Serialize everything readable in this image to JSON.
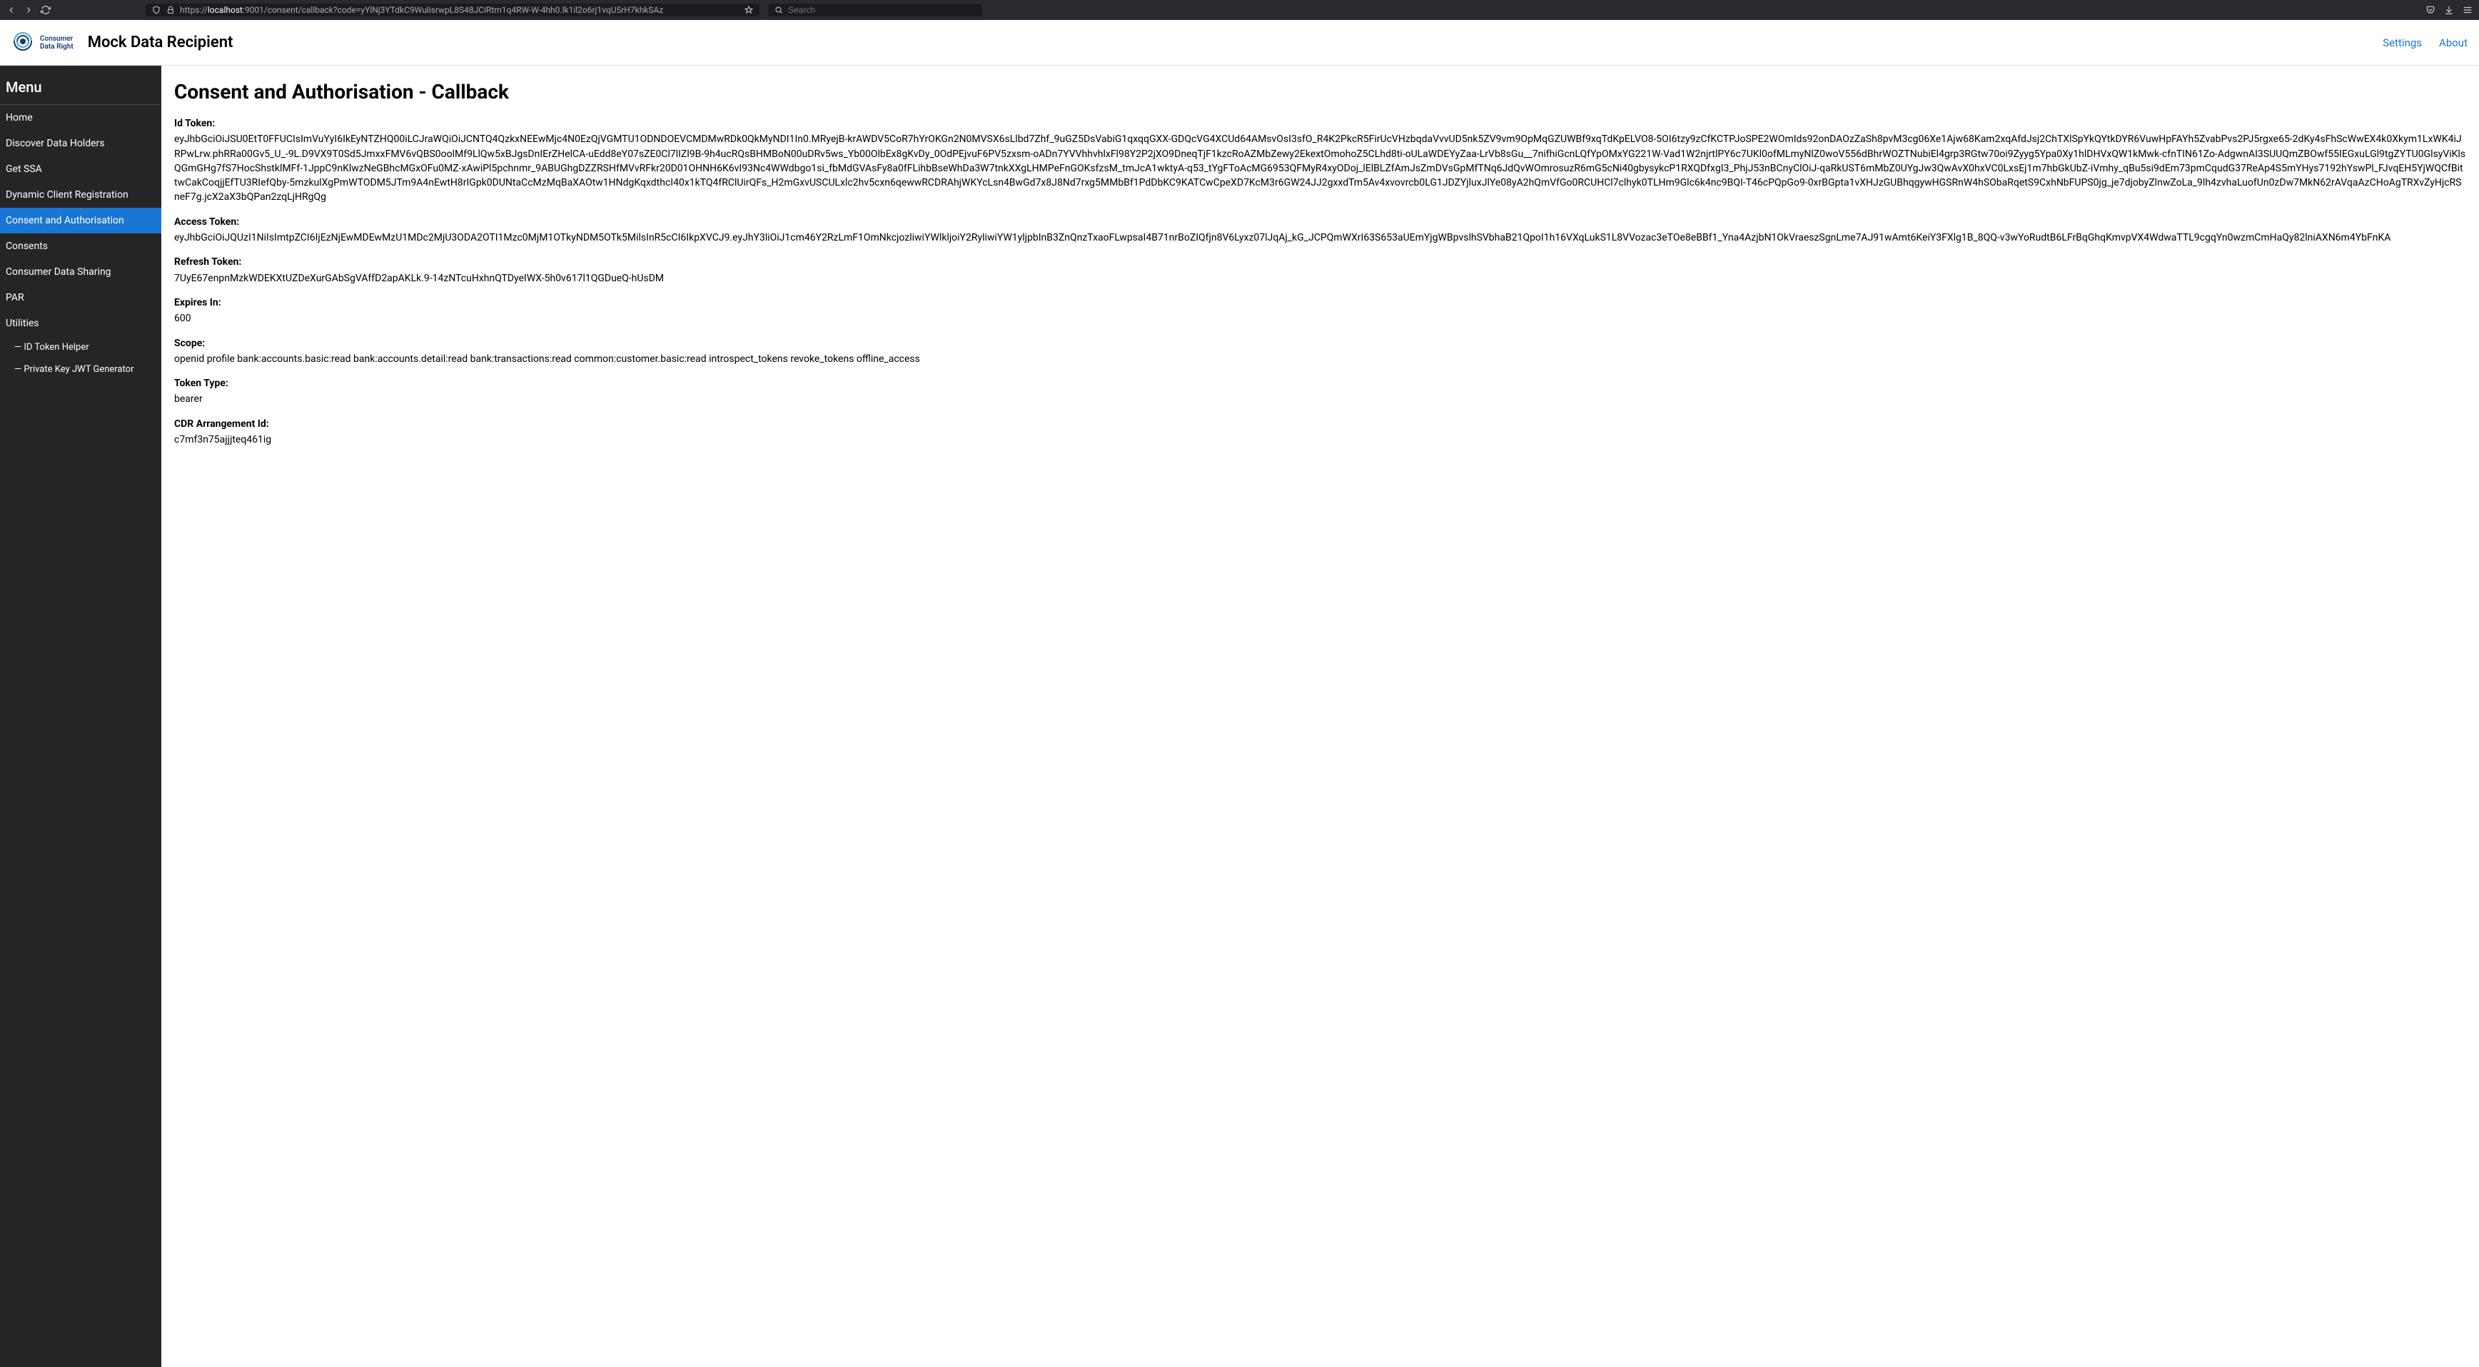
{
  "browser": {
    "url_prefix": "https://",
    "url_host": "localhost",
    "url_rest": ":9001/consent/callback?code=yYlNj3YTdkC9WulisrwpL8S48JCiRtm1q4RW-W-4hh0.lk1il2o6rj1vqU5rH7khkSAz",
    "search_placeholder": "Search"
  },
  "header": {
    "logo_line1": "Consumer",
    "logo_line2": "Data Right",
    "app_title": "Mock Data Recipient",
    "links": {
      "settings": "Settings",
      "about": "About"
    }
  },
  "sidebar": {
    "menu_label": "Menu",
    "items": [
      {
        "label": "Home",
        "active": false
      },
      {
        "label": "Discover Data Holders",
        "active": false
      },
      {
        "label": "Get SSA",
        "active": false
      },
      {
        "label": "Dynamic Client Registration",
        "active": false
      },
      {
        "label": "Consent and Authorisation",
        "active": true
      },
      {
        "label": "Consents",
        "active": false
      },
      {
        "label": "Consumer Data Sharing",
        "active": false
      },
      {
        "label": "PAR",
        "active": false
      },
      {
        "label": "Utilities",
        "active": false
      }
    ],
    "subitems": [
      {
        "label": "— ID Token Helper"
      },
      {
        "label": "— Private Key JWT Generator"
      }
    ]
  },
  "main": {
    "title": "Consent and Authorisation - Callback",
    "fields": [
      {
        "label": "Id Token:",
        "value": "eyJhbGciOiJSU0EtT0FFUCIsImVuYyI6IkEyNTZHQ00iLCJraWQiOiJCNTQ4QzkxNEEwMjc4N0EzQjVGMTU1ODNDOEVCMDMwRDk0QkMyNDI1In0.MRyejB-krAWDV5CoR7hYrOKGn2N0MVSX6sLlbd7Zhf_9uGZ5DsVabiG1qxqqGXX-GDQcVG4XCUd64AMsvOsI3sfO_R4K2PkcR5FirUcVHzbqdaVvvUD5nk5ZV9vm9OpMqGZUWBf9xqTdKpELVO8-5OI6tzy9zCfKCTPJoSPE2WOmIds92onDAOzZaSh8pvM3cg06Xe1Ajw68Kam2xqAfdJsj2ChTXlSpYkQYtkDYR6VuwHpFAYh5ZvabPvs2PJ5rgxe65-2dKy4sFhScWwEX4k0Xkym1LxWK4iJRPwLrw.phRRa00Gv5_U_-9L.D9VX9T0Sd5JmxxFMV6vQBS0oolMf9LlQw5xBJgsDnIErZHelCA-uEdd8eY07sZE0Cl7lIZl9B-9h4ucRQsBHMBoN00uDRv5ws_Yb00OlbEx8gKvDy_0OdPEjvuF6PV5zxsm-oADn7YVVhhvhlxFl98Y2P2jXO9DneqTjF1kzcRoAZMbZewy2EkextOmohoZ5CLhd8ti-oULaWDEYyZaa-LrVb8sGu__7nifhiGcnLQfYpOMxYG221W-Vad1W2njrtlPY6c7UKl0ofMLmyNlZ0woV556dBhrWOZTNubiEl4grp3RGtw70oi9Zyyg5Ypa0Xy1hlDHVxQW1kMwk-cfnTIN61Zo-AdgwnAI3SUUQmZBOwf55IEGxuLGl9tgZYTU0GlsyViKlsQGmGHg7fS7HocShstklMFf-1JppC9nKlwzNeGBhcMGxOFu0MZ-xAwiPl5pchnmr_9ABUGhgDZZRSHfMVvRFkr20D01OHNH6K6vI93Nc4WWdbgo1si_fbMdGVAsFy8a0fFLihbBseWhDa3W7tnkXXgLHMPeFnGOKsfzsM_tmJcA1wktyA-q53_tYgFToAcMG6953QFMyR4xyODoj_lElBLZfAmJsZmDVsGpMfTNq6JdQvWOmrosuzR6mG5cNi40gbysykcP1RXQDfxgI3_PhjJ53nBCnyClOiJ-qaRkUST6mMbZ0UYgJw3QwAvX0hxVC0LxsEj1m7hbGkUbZ-iVmhy_qBu5si9dEm73pmCqudG37ReAp4S5mYHys7192hYswPl_FJvqEH5YjWQCfBittwCakCoqjjEfTU3RIefQby-5mzkulXgPmWTODM5JTm9A4nEwtH8rIGpk0DUNtaCcMzMqBaXAOtw1HNdgKqxdthcI40x1kTQ4fRClUirQFs_H2mGxvUSCULxlc2hv5cxn6qewwRCDRAhjWKYcLsn4BwGd7x8J8Nd7rxg5MMbBf1PdDbKC9KATCwCpeXD7KcM3r6GW24JJ2gxxdTm5Av4xvovrcb0LG1JDZYjluxJlYe08yA2hQmVfGo0RCUHCl7clhyk0TLHm9Glc6k4nc9BQI-T46cPQpGo9-0xrBGpta1vXHJzGUBhqgywHGSRnW4hSObaRqetS9CxhNbFUPS0jg_je7djobyZlnwZoLa_9lh4zvhaLuofUn0zDw7MkN62rAVqaAzCHoAgTRXvZyHjcRSneF7g.jcX2aX3bQPan2zqLjHRgQg"
      },
      {
        "label": "Access Token:",
        "value": "eyJhbGciOiJQUzI1NiIsImtpZCI6IjEzNjEwMDEwMzU1MDc2MjU3ODA2OTI1Mzc0MjM1OTkyNDM5OTk5MilsInR5cCI6IkpXVCJ9.eyJhY3liOiJ1cm46Y2RzLmF1OmNkcjozliwiYWlkljoiY2RyliwiYW1yljpbInB3ZnQnzTxaoFLwpsaI4B71nrBoZIQfjn8V6Lyxz07lJqAj_kG_JCPQmWXrI63S653aUEmYjgWBpvslhSVbhaB21QpoI1h16VXqLukS1L8VVozac3eTOe8eBBf1_Yna4AzjbN1OkVraeszSgnLme7AJ91wAmt6KeiY3FXlg1B_8QQ-v3wYoRudtB6LFrBqGhqKmvpVX4WdwaTTL9cgqYn0wzmCmHaQy82lniAXN6m4YbFnKA"
      },
      {
        "label": "Refresh Token:",
        "value": "7UyE67enpnMzkWDEKXtUZDeXurGAbSgVAffD2apAKLk.9-14zNTcuHxhnQTDyeIWX-5h0v617l1QGDueQ-hUsDM"
      },
      {
        "label": "Expires In:",
        "value": "600"
      },
      {
        "label": "Scope:",
        "value": "openid profile bank:accounts.basic:read bank:accounts.detail:read bank:transactions:read common:customer.basic:read introspect_tokens revoke_tokens offline_access"
      },
      {
        "label": "Token Type:",
        "value": "bearer"
      },
      {
        "label": "CDR Arrangement Id:",
        "value": "c7mf3n75ajjjteq461ig"
      }
    ]
  }
}
